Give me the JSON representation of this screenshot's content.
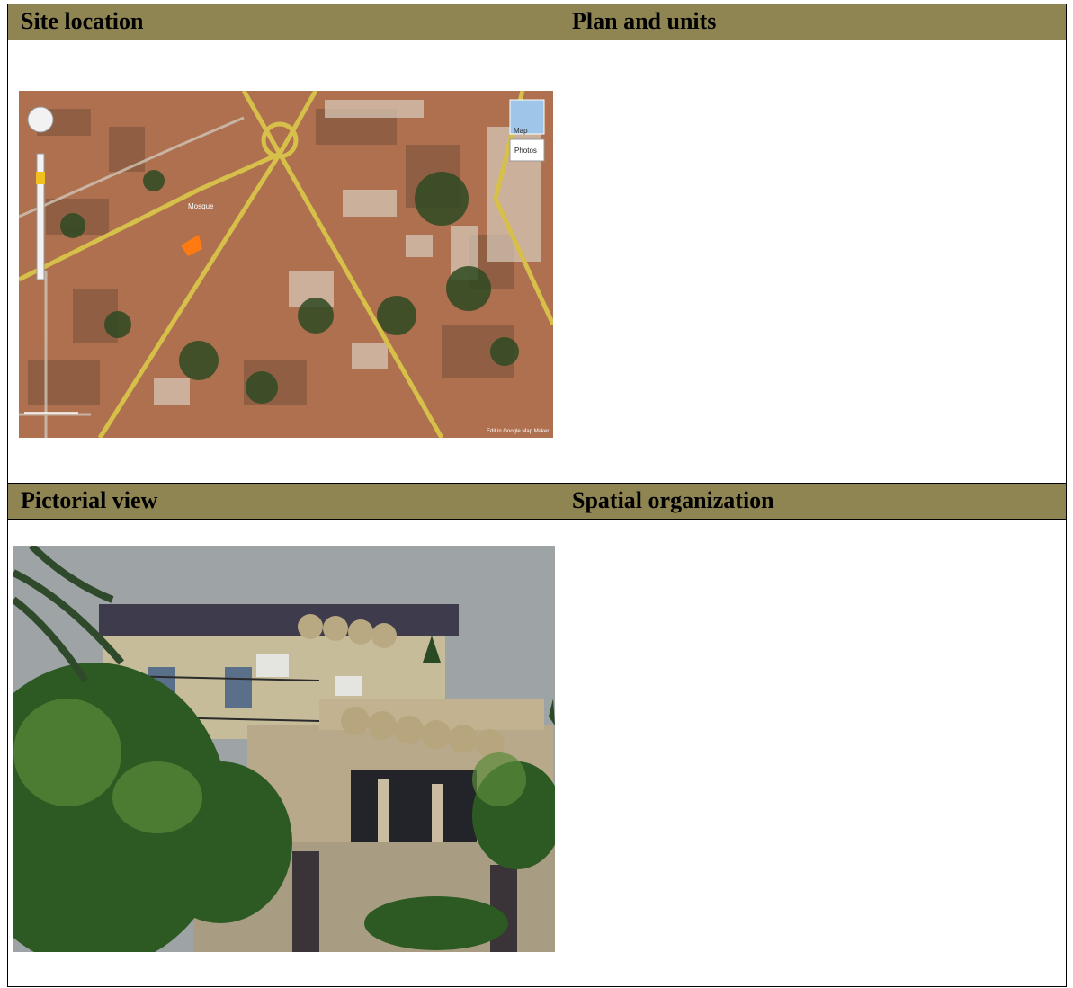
{
  "headers": {
    "site_location": "Site location",
    "plan_and_units": "Plan and units",
    "pictorial_view": "Pictorial view",
    "spatial_organization": "Spatial organization"
  },
  "map": {
    "btn_map": "Map",
    "btn_photos": "Photos",
    "poi_mosque": "Mosque",
    "edit_link": "Edit in Google Map Maker"
  },
  "colors": {
    "header_bg": "#8f8552",
    "border": "#000000"
  }
}
